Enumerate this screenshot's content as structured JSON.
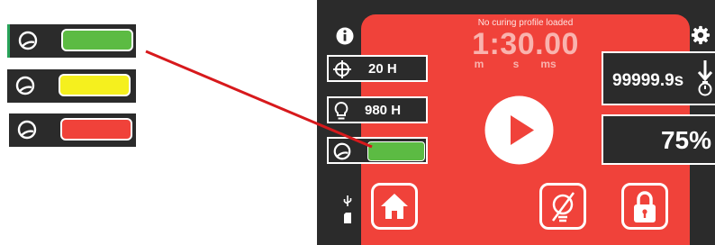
{
  "legend": {
    "strips": [
      {
        "status": "green",
        "fill": "#5cbb43"
      },
      {
        "status": "yellow",
        "fill": "#f5f01e"
      },
      {
        "status": "red",
        "fill": "#f0423a"
      }
    ]
  },
  "device": {
    "panel_color": "#f0423a",
    "profile_status": "No curing profile loaded",
    "timer": {
      "value": "1:30.00",
      "units": [
        "m",
        "s",
        "ms"
      ]
    },
    "left_readouts": [
      {
        "icon": "crosshair-icon",
        "value": "20 H"
      },
      {
        "icon": "lightbulb-icon",
        "value": "980 H"
      }
    ],
    "sensor_status_color": "#5cbb43",
    "right_readouts": {
      "time_value": "99999.9s",
      "percent_value": "75%"
    },
    "icons": {
      "info": "info-icon",
      "settings": "gear-icon",
      "play": "play-icon",
      "home": "home-icon",
      "no_sensor": "sensor-off-icon",
      "lock": "lock-icon",
      "usb": "usb-icon",
      "sd": "sd-card-icon"
    },
    "annotation_line_color": "#d7191c"
  }
}
